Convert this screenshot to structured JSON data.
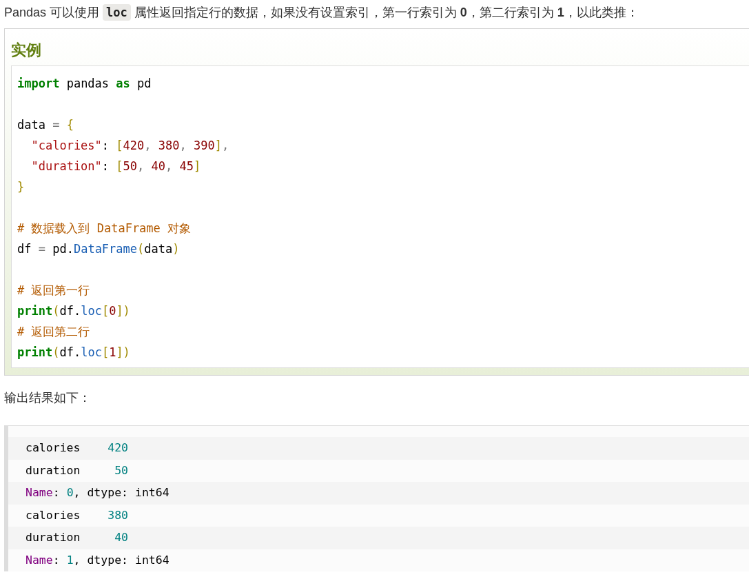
{
  "intro": {
    "before": "Pandas 可以使用",
    "code": "loc",
    "after": "属性返回指定行的数据，如果没有设置索引，第一行索引为 **0**，第二行索引为 **1**，以此类推："
  },
  "example": {
    "heading": "实例",
    "lines": [
      {
        "kind": "code",
        "tokens": [
          {
            "t": "import",
            "kind": "kw"
          },
          {
            "t": " pandas ",
            "kind": "plain"
          },
          {
            "t": "as",
            "kind": "kw"
          },
          {
            "t": " pd",
            "kind": "plain"
          }
        ]
      },
      {
        "kind": "blank"
      },
      {
        "kind": "code",
        "tokens": [
          {
            "t": "data ",
            "kind": "plain"
          },
          {
            "t": "=",
            "kind": "op"
          },
          {
            "t": " {",
            "kind": "br"
          }
        ]
      },
      {
        "kind": "code",
        "tokens": [
          {
            "t": "  \"calories\"",
            "kind": "str"
          },
          {
            "t": ": ",
            "kind": "plain"
          },
          {
            "t": "[",
            "kind": "br"
          },
          {
            "t": "420",
            "kind": "num"
          },
          {
            "t": ", ",
            "kind": "op"
          },
          {
            "t": "380",
            "kind": "num"
          },
          {
            "t": ", ",
            "kind": "op"
          },
          {
            "t": "390",
            "kind": "num"
          },
          {
            "t": "]",
            "kind": "br"
          },
          {
            "t": ",",
            "kind": "op"
          }
        ]
      },
      {
        "kind": "code",
        "tokens": [
          {
            "t": "  \"duration\"",
            "kind": "str"
          },
          {
            "t": ": ",
            "kind": "plain"
          },
          {
            "t": "[",
            "kind": "br"
          },
          {
            "t": "50",
            "kind": "num"
          },
          {
            "t": ", ",
            "kind": "op"
          },
          {
            "t": "40",
            "kind": "num"
          },
          {
            "t": ", ",
            "kind": "op"
          },
          {
            "t": "45",
            "kind": "num"
          },
          {
            "t": "]",
            "kind": "br"
          }
        ]
      },
      {
        "kind": "code",
        "tokens": [
          {
            "t": "}",
            "kind": "br"
          }
        ]
      },
      {
        "kind": "blank"
      },
      {
        "kind": "code",
        "tokens": [
          {
            "t": "# 数据载入到 DataFrame 对象",
            "kind": "cm"
          }
        ]
      },
      {
        "kind": "code",
        "tokens": [
          {
            "t": "df ",
            "kind": "plain"
          },
          {
            "t": "=",
            "kind": "op"
          },
          {
            "t": " pd.",
            "kind": "plain"
          },
          {
            "t": "DataFrame",
            "kind": "fn"
          },
          {
            "t": "(",
            "kind": "br"
          },
          {
            "t": "data",
            "kind": "plain"
          },
          {
            "t": ")",
            "kind": "br"
          }
        ]
      },
      {
        "kind": "blank"
      },
      {
        "kind": "code",
        "tokens": [
          {
            "t": "# 返回第一行",
            "kind": "cm"
          }
        ]
      },
      {
        "kind": "code",
        "tokens": [
          {
            "t": "print",
            "kind": "kw"
          },
          {
            "t": "(",
            "kind": "br"
          },
          {
            "t": "df.",
            "kind": "plain"
          },
          {
            "t": "loc",
            "kind": "fn"
          },
          {
            "t": "[",
            "kind": "br"
          },
          {
            "t": "0",
            "kind": "num"
          },
          {
            "t": "])",
            "kind": "br"
          }
        ]
      },
      {
        "kind": "code",
        "tokens": [
          {
            "t": "# 返回第二行",
            "kind": "cm"
          }
        ]
      },
      {
        "kind": "code",
        "tokens": [
          {
            "t": "print",
            "kind": "kw"
          },
          {
            "t": "(",
            "kind": "br"
          },
          {
            "t": "df.",
            "kind": "plain"
          },
          {
            "t": "loc",
            "kind": "fn"
          },
          {
            "t": "[",
            "kind": "br"
          },
          {
            "t": "1",
            "kind": "num"
          },
          {
            "t": "])",
            "kind": "br"
          }
        ]
      }
    ]
  },
  "output_label": "输出结果如下：",
  "output": [
    {
      "tokens": [
        {
          "t": "calories    ",
          "kind": "plain"
        },
        {
          "t": "420",
          "kind": "num"
        }
      ]
    },
    {
      "tokens": [
        {
          "t": "duration     ",
          "kind": "plain"
        },
        {
          "t": "50",
          "kind": "num"
        }
      ]
    },
    {
      "tokens": [
        {
          "t": "Name",
          "kind": "name"
        },
        {
          "t": ": ",
          "kind": "plain"
        },
        {
          "t": "0",
          "kind": "num"
        },
        {
          "t": ", dtype: int64",
          "kind": "plain"
        }
      ]
    },
    {
      "tokens": [
        {
          "t": "calories    ",
          "kind": "plain"
        },
        {
          "t": "380",
          "kind": "num"
        }
      ]
    },
    {
      "tokens": [
        {
          "t": "duration     ",
          "kind": "plain"
        },
        {
          "t": "40",
          "kind": "num"
        }
      ]
    },
    {
      "tokens": [
        {
          "t": "Name",
          "kind": "name"
        },
        {
          "t": ": ",
          "kind": "plain"
        },
        {
          "t": "1",
          "kind": "num"
        },
        {
          "t": ", dtype: int64",
          "kind": "plain"
        }
      ]
    }
  ]
}
